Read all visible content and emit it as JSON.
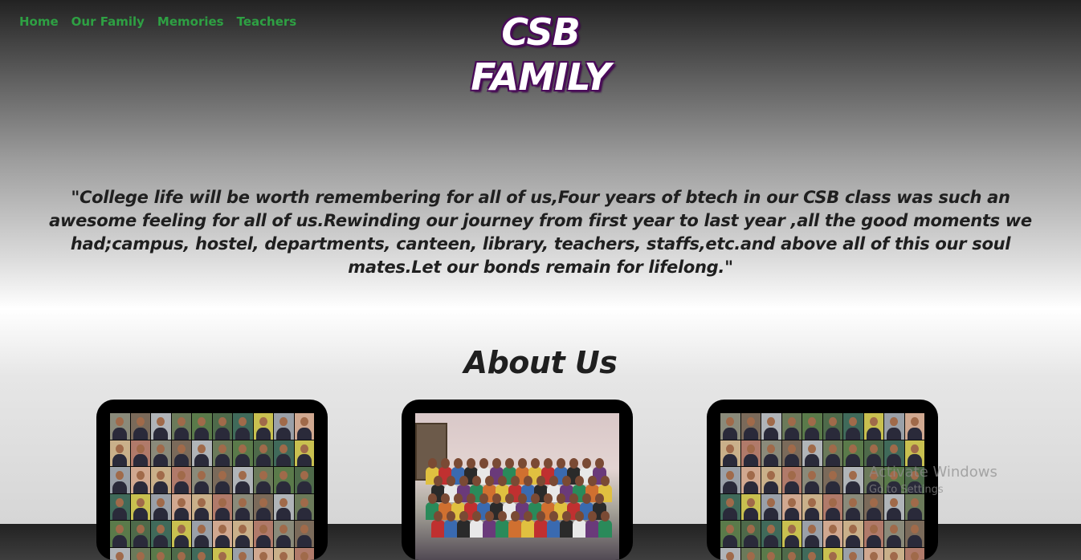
{
  "nav": {
    "items": [
      {
        "label": "Home"
      },
      {
        "label": "Our Family"
      },
      {
        "label": "Memories"
      },
      {
        "label": "Teachers"
      }
    ]
  },
  "hero": {
    "title_line1": "CSB",
    "title_line2": "FAMILY",
    "quote": "\"College life will be worth remembering for all of us,Four years of btech in our CSB class was such an awesome feeling for all of us.Rewinding our journey from first year to last year ,all the good moments we had;campus, hostel, departments, canteen, library, teachers, staffs,etc.and above all of this our soul mates.Let our bonds remain for lifelong.\""
  },
  "about": {
    "heading": "About Us"
  },
  "watermark": {
    "line1": "Activate Windows",
    "line2": "Go to Settings"
  },
  "colors": {
    "nav_link": "#2ea043",
    "title_outline": "#4a0a5a",
    "text_dark": "#1f1f1f",
    "card_bg": "#000000"
  }
}
